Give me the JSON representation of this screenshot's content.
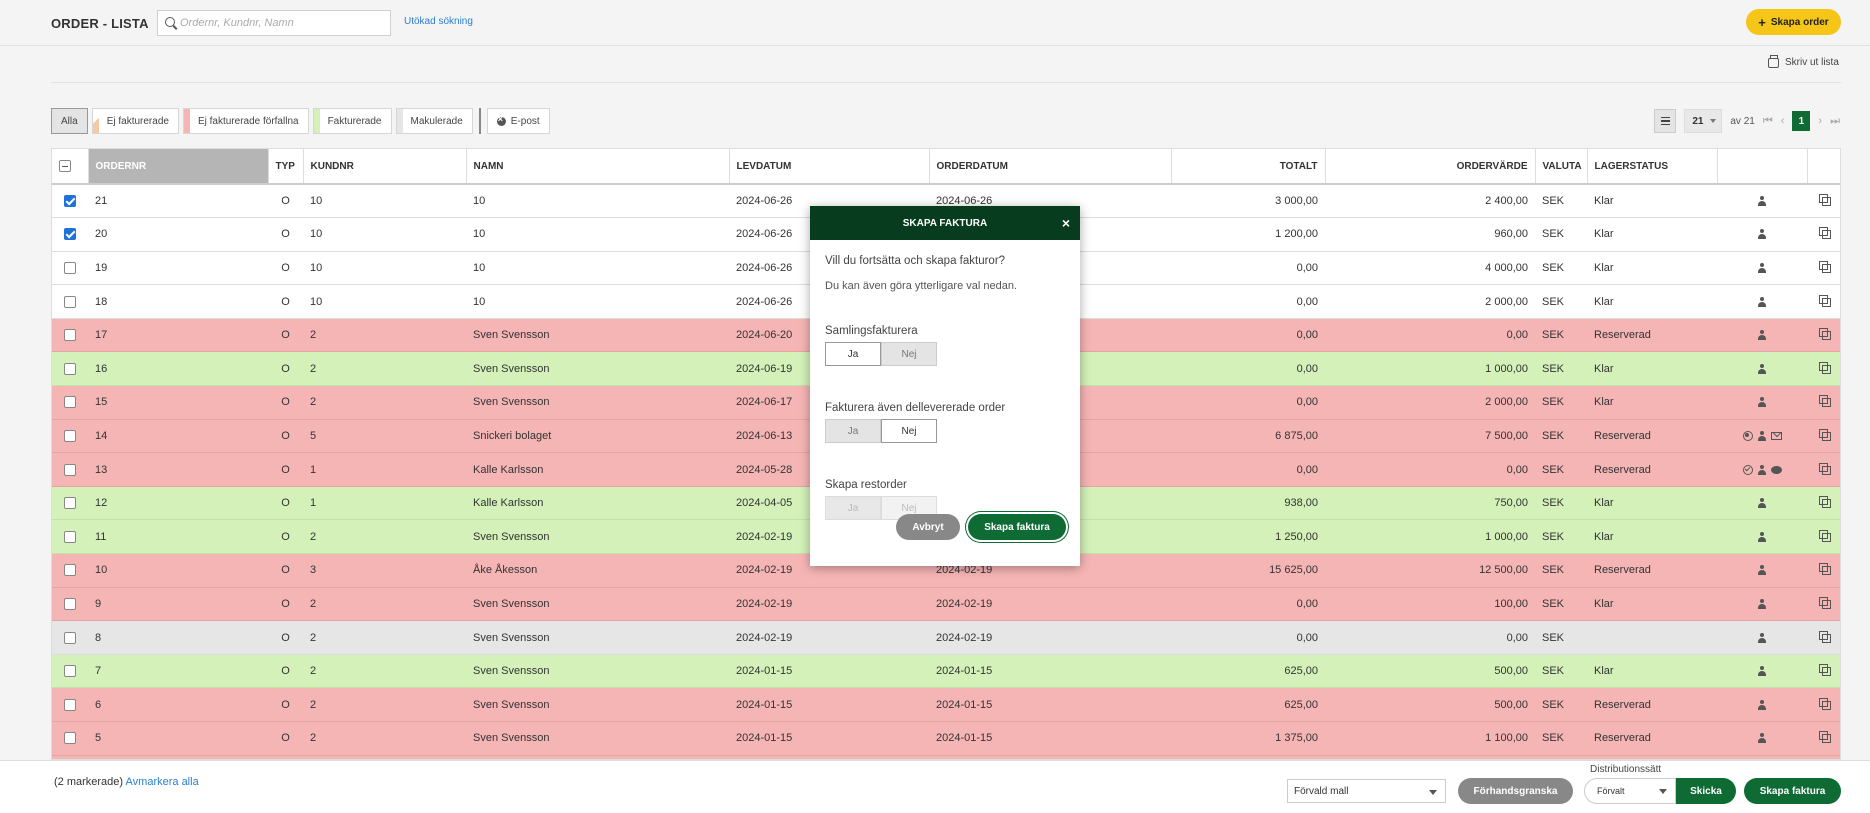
{
  "header": {
    "title": "ORDER - LISTA",
    "search_placeholder": "Ordernr, Kundnr, Namn",
    "advanced_search": "Utökad sökning",
    "create_order": "Skapa order",
    "print_list": "Skriv ut lista"
  },
  "filters": {
    "all": "Alla",
    "not_invoiced": "Ej fakturerade",
    "not_invoiced_overdue": "Ej fakturerade förfallna",
    "invoiced": "Fakturerade",
    "voided": "Makulerade",
    "email": "E-post",
    "colors": {
      "not_invoiced": "#f3c9a8",
      "overdue": "#f6b5b5",
      "invoiced": "#d3f1b9",
      "voided": "#e6e6e6"
    }
  },
  "pager": {
    "per_page": "21",
    "of_label": "av 21",
    "current": "1"
  },
  "table": {
    "columns": {
      "ordernr": "ORDERNR",
      "typ": "TYP",
      "kundnr": "KUNDNR",
      "namn": "NAMN",
      "levdatum": "LEVDATUM",
      "orderdatum": "ORDERDATUM",
      "totalt": "TOTALT",
      "ordervarde": "ORDERVÄRDE",
      "valuta": "VALUTA",
      "lagerstatus": "LAGERSTATUS"
    },
    "rows": [
      {
        "status": "white",
        "checked": true,
        "ordernr": "21",
        "typ": "O",
        "kundnr": "10",
        "namn": "10",
        "levdatum": "2024-06-26",
        "orderdatum": "2024-06-26",
        "totalt": "3 000,00",
        "ordervarde": "2 400,00",
        "valuta": "SEK",
        "lagerstatus": "Klar",
        "icons": [
          "person"
        ]
      },
      {
        "status": "white",
        "checked": true,
        "ordernr": "20",
        "typ": "O",
        "kundnr": "10",
        "namn": "10",
        "levdatum": "2024-06-26",
        "orderdatum": "",
        "totalt": "1 200,00",
        "ordervarde": "960,00",
        "valuta": "SEK",
        "lagerstatus": "Klar",
        "icons": [
          "person"
        ]
      },
      {
        "status": "white",
        "checked": false,
        "ordernr": "19",
        "typ": "O",
        "kundnr": "10",
        "namn": "10",
        "levdatum": "2024-06-26",
        "orderdatum": "",
        "totalt": "0,00",
        "ordervarde": "4 000,00",
        "valuta": "SEK",
        "lagerstatus": "Klar",
        "icons": [
          "person"
        ]
      },
      {
        "status": "white",
        "checked": false,
        "ordernr": "18",
        "typ": "O",
        "kundnr": "10",
        "namn": "10",
        "levdatum": "2024-06-26",
        "orderdatum": "",
        "totalt": "0,00",
        "ordervarde": "2 000,00",
        "valuta": "SEK",
        "lagerstatus": "Klar",
        "icons": [
          "person"
        ]
      },
      {
        "status": "red",
        "checked": false,
        "ordernr": "17",
        "typ": "O",
        "kundnr": "2",
        "namn": "Sven Svensson",
        "levdatum": "2024-06-20",
        "orderdatum": "",
        "totalt": "0,00",
        "ordervarde": "0,00",
        "valuta": "SEK",
        "lagerstatus": "Reserverad",
        "icons": [
          "person"
        ]
      },
      {
        "status": "green",
        "checked": false,
        "ordernr": "16",
        "typ": "O",
        "kundnr": "2",
        "namn": "Sven Svensson",
        "levdatum": "2024-06-19",
        "orderdatum": "",
        "totalt": "0,00",
        "ordervarde": "1 000,00",
        "valuta": "SEK",
        "lagerstatus": "Klar",
        "icons": [
          "person"
        ]
      },
      {
        "status": "red",
        "checked": false,
        "ordernr": "15",
        "typ": "O",
        "kundnr": "2",
        "namn": "Sven Svensson",
        "levdatum": "2024-06-17",
        "orderdatum": "",
        "totalt": "0,00",
        "ordervarde": "2 000,00",
        "valuta": "SEK",
        "lagerstatus": "Klar",
        "icons": [
          "person"
        ]
      },
      {
        "status": "red",
        "checked": false,
        "ordernr": "14",
        "typ": "O",
        "kundnr": "5",
        "namn": "Snickeri bolaget",
        "levdatum": "2024-06-13",
        "orderdatum": "",
        "totalt": "6 875,00",
        "ordervarde": "7 500,00",
        "valuta": "SEK",
        "lagerstatus": "Reserverad",
        "icons": [
          "xcircle",
          "person",
          "mail"
        ]
      },
      {
        "status": "red",
        "checked": false,
        "ordernr": "13",
        "typ": "O",
        "kundnr": "1",
        "namn": "Kalle Karlsson",
        "levdatum": "2024-05-28",
        "orderdatum": "",
        "totalt": "0,00",
        "ordervarde": "0,00",
        "valuta": "SEK",
        "lagerstatus": "Reserverad",
        "icons": [
          "checkcircle",
          "person",
          "chat"
        ]
      },
      {
        "status": "green",
        "checked": false,
        "ordernr": "12",
        "typ": "O",
        "kundnr": "1",
        "namn": "Kalle Karlsson",
        "levdatum": "2024-04-05",
        "orderdatum": "",
        "totalt": "938,00",
        "ordervarde": "750,00",
        "valuta": "SEK",
        "lagerstatus": "Klar",
        "icons": [
          "person"
        ]
      },
      {
        "status": "green",
        "checked": false,
        "ordernr": "11",
        "typ": "O",
        "kundnr": "2",
        "namn": "Sven Svensson",
        "levdatum": "2024-02-19",
        "orderdatum": "",
        "totalt": "1 250,00",
        "ordervarde": "1 000,00",
        "valuta": "SEK",
        "lagerstatus": "Klar",
        "icons": [
          "person"
        ]
      },
      {
        "status": "red",
        "checked": false,
        "ordernr": "10",
        "typ": "O",
        "kundnr": "3",
        "namn": "Åke Åkesson",
        "levdatum": "2024-02-19",
        "orderdatum": "2024-02-19",
        "totalt": "15 625,00",
        "ordervarde": "12 500,00",
        "valuta": "SEK",
        "lagerstatus": "Reserverad",
        "icons": [
          "person"
        ]
      },
      {
        "status": "red",
        "checked": false,
        "ordernr": "9",
        "typ": "O",
        "kundnr": "2",
        "namn": "Sven Svensson",
        "levdatum": "2024-02-19",
        "orderdatum": "2024-02-19",
        "totalt": "0,00",
        "ordervarde": "100,00",
        "valuta": "SEK",
        "lagerstatus": "Klar",
        "icons": [
          "person"
        ]
      },
      {
        "status": "grey",
        "checked": false,
        "ordernr": "8",
        "typ": "O",
        "kundnr": "2",
        "namn": "Sven Svensson",
        "levdatum": "2024-02-19",
        "orderdatum": "2024-02-19",
        "totalt": "0,00",
        "ordervarde": "0,00",
        "valuta": "SEK",
        "lagerstatus": "",
        "icons": [
          "person"
        ]
      },
      {
        "status": "green",
        "checked": false,
        "ordernr": "7",
        "typ": "O",
        "kundnr": "2",
        "namn": "Sven Svensson",
        "levdatum": "2024-01-15",
        "orderdatum": "2024-01-15",
        "totalt": "625,00",
        "ordervarde": "500,00",
        "valuta": "SEK",
        "lagerstatus": "Klar",
        "icons": [
          "person"
        ]
      },
      {
        "status": "red",
        "checked": false,
        "ordernr": "6",
        "typ": "O",
        "kundnr": "2",
        "namn": "Sven Svensson",
        "levdatum": "2024-01-15",
        "orderdatum": "2024-01-15",
        "totalt": "625,00",
        "ordervarde": "500,00",
        "valuta": "SEK",
        "lagerstatus": "Reserverad",
        "icons": [
          "person"
        ]
      },
      {
        "status": "red",
        "checked": false,
        "ordernr": "5",
        "typ": "O",
        "kundnr": "2",
        "namn": "Sven Svensson",
        "levdatum": "2024-01-15",
        "orderdatum": "2024-01-15",
        "totalt": "1 375,00",
        "ordervarde": "1 100,00",
        "valuta": "SEK",
        "lagerstatus": "Reserverad",
        "icons": [
          "person"
        ]
      },
      {
        "status": "red",
        "checked": false,
        "ordernr": "",
        "typ": "",
        "kundnr": "",
        "namn": "",
        "levdatum": "",
        "orderdatum": "",
        "totalt": "",
        "ordervarde": "",
        "valuta": "",
        "lagerstatus": "",
        "icons": []
      }
    ]
  },
  "modal": {
    "title": "SKAPA FAKTURA",
    "question": "Vill du fortsätta och skapa fakturor?",
    "subtext": "Du kan även göra ytterligare val nedan.",
    "options": [
      {
        "label": "Samlingsfakturera",
        "yes": "Ja",
        "no": "Nej",
        "selected": "yes",
        "disabled": false
      },
      {
        "label": "Fakturera även dellevererade order",
        "yes": "Ja",
        "no": "Nej",
        "selected": "no",
        "disabled": false
      },
      {
        "label": "Skapa restorder",
        "yes": "Ja",
        "no": "Nej",
        "selected": "",
        "disabled": true
      }
    ],
    "cancel": "Avbryt",
    "confirm": "Skapa faktura"
  },
  "footer": {
    "selected_count": "(2 markerade)",
    "deselect_all": "Avmarkera alla",
    "template_value": "Förvald mall",
    "preview": "Förhandsgranska",
    "distribution_label": "Distributionssätt",
    "distribution_value": "Förvalt",
    "send": "Skicka",
    "create_invoice": "Skapa faktura"
  }
}
